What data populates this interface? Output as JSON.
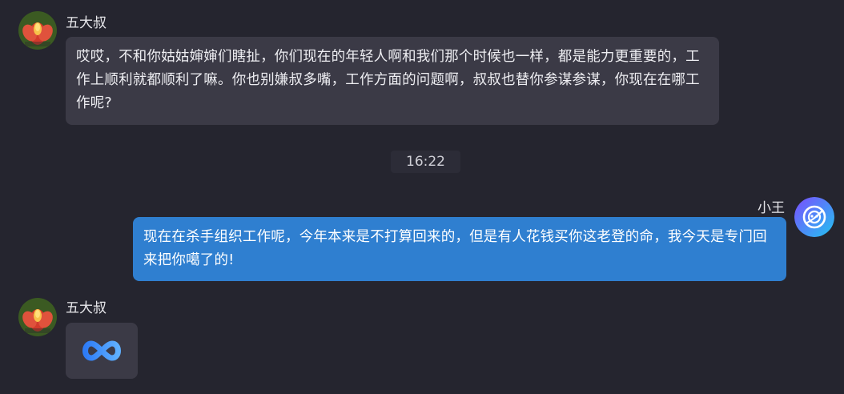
{
  "messages": [
    {
      "sender": "五大叔",
      "text": "哎哎，不和你姑姑婶婶们瞎扯，你们现在的年轻人啊和我们那个时候也一样，都是能力更重要的，工作上顺利就都顺利了嘛。你也别嫌叔多嘴，工作方面的问题啊，叔叔也替你参谋参谋，你现在在哪工作呢?"
    },
    {
      "timestamp": "16:22"
    },
    {
      "sender": "小王",
      "text": "现在在杀手组织工作呢，今年本来是不打算回来的，但是有人花钱买你这老登的命，我今天是专门回来把你噶了的!"
    },
    {
      "sender": "五大叔",
      "attachment_icon": "infinity-icon"
    }
  ],
  "colors": {
    "background": "#25252f",
    "incoming_bubble": "#3b3a46",
    "outgoing_bubble": "#2f7fd0",
    "text": "#e6e6ea"
  }
}
